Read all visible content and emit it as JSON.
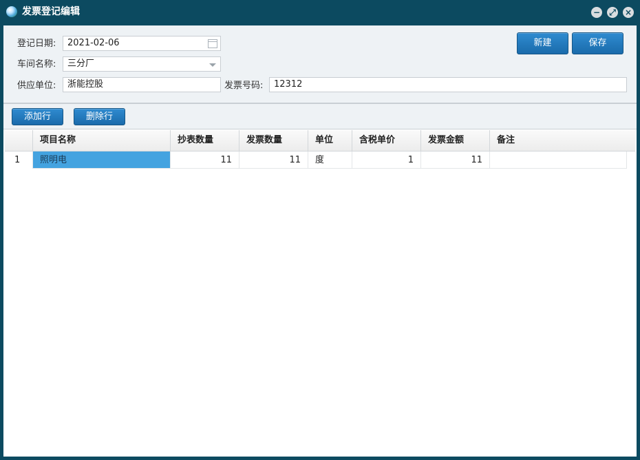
{
  "window": {
    "title": "发票登记编辑",
    "controls": {
      "minimize": "−",
      "maximize": "⤢",
      "close": "×"
    }
  },
  "form": {
    "date_label": "登记日期:",
    "date_value": "2021-02-06",
    "workshop_label": "车间名称:",
    "workshop_value": "三分厂",
    "supplier_label": "供应单位:",
    "supplier_value": "浙能控股",
    "invoice_no_label": "发票号码:",
    "invoice_no_value": "12312"
  },
  "actions": {
    "new_label": "新建",
    "save_label": "保存"
  },
  "grid_toolbar": {
    "add_row_label": "添加行",
    "delete_row_label": "删除行"
  },
  "grid": {
    "columns": [
      "项目名称",
      "抄表数量",
      "发票数量",
      "单位",
      "含税单价",
      "发票金额",
      "备注"
    ],
    "rows": [
      {
        "index": "1",
        "item": "照明电",
        "meter_qty": "11",
        "invoice_qty": "11",
        "unit": "度",
        "unit_price": "1",
        "amount": "11",
        "remark": ""
      }
    ]
  },
  "icons": {
    "app": "globe-icon",
    "date_picker": "calendar-icon",
    "dropdown": "chevron-down-icon"
  },
  "colors": {
    "titlebar": "#0c4a60",
    "button": "#1a6bab",
    "selected_cell": "#44a3e0"
  }
}
